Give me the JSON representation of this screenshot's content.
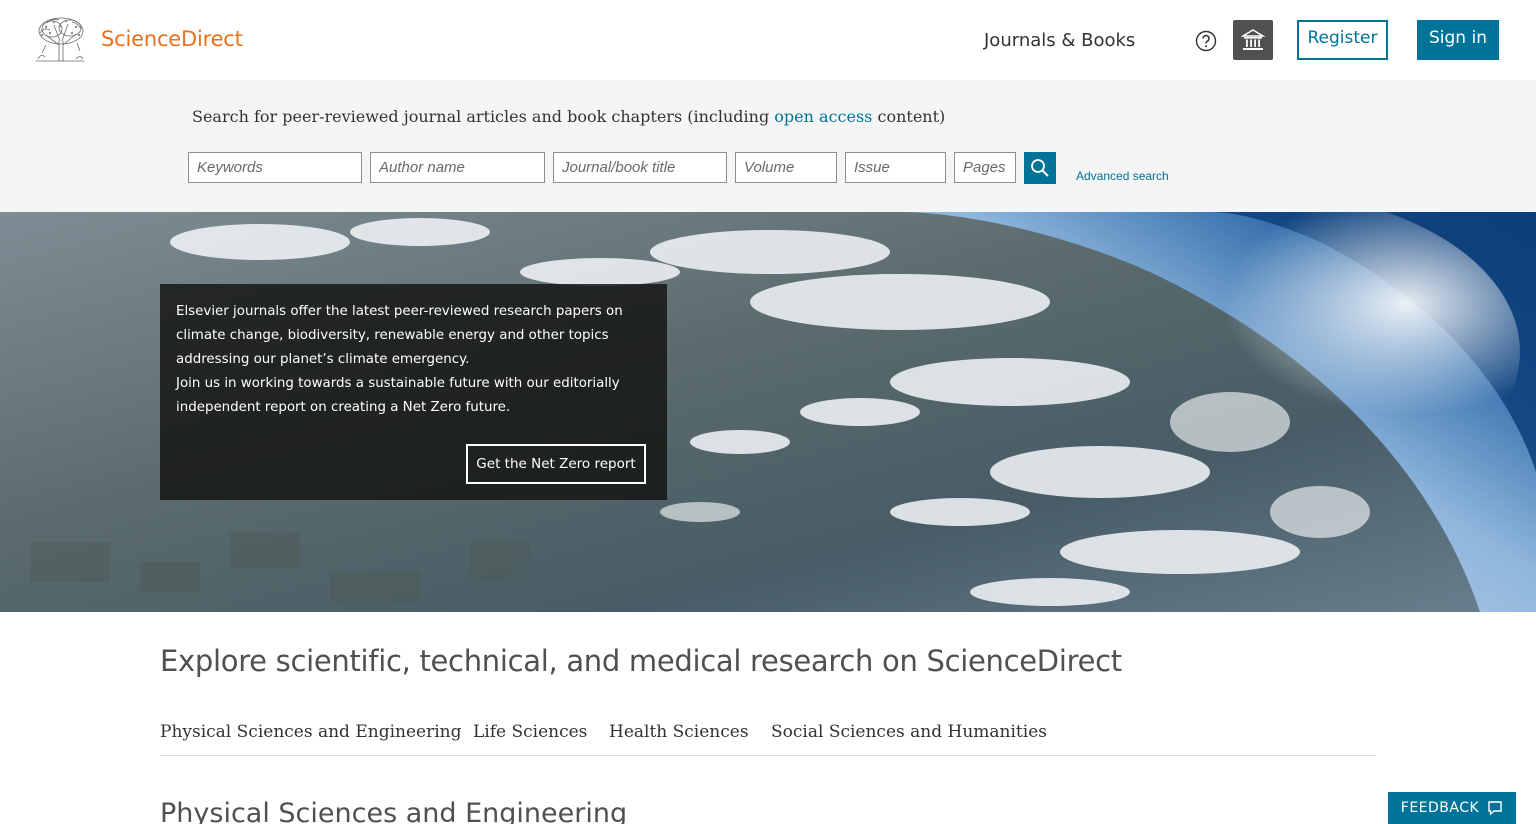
{
  "header": {
    "brand": "ScienceDirect",
    "nav_journals": "Journals & Books",
    "help_icon": "help-circle-icon",
    "institution_icon": "institution-icon",
    "register_label": "Register",
    "signin_label": "Sign in"
  },
  "search": {
    "intro_prefix": "Search for peer-reviewed journal articles and book chapters (including",
    "intro_link": "open access",
    "intro_suffix": "content)",
    "keywords_placeholder": "Keywords",
    "author_placeholder": "Author name",
    "journal_placeholder": "Journal/book title",
    "volume_placeholder": "Volume",
    "issue_placeholder": "Issue",
    "pages_placeholder": "Pages",
    "submit_icon": "search-icon",
    "advanced_label": "Advanced search"
  },
  "hero": {
    "paragraph_1": "Elsevier journals offer the latest peer-reviewed research papers on climate change, biodiversity, renewable energy and other topics addressing our planet’s climate emergency.",
    "paragraph_2": "Join us in working towards a sustainable future with our editorially independent report on creating a Net Zero future.",
    "cta_label": "Get the Net Zero report"
  },
  "explore": {
    "title": "Explore scientific, technical, and medical research on ScienceDirect",
    "tabs": [
      {
        "label": "Physical Sciences and Engineering"
      },
      {
        "label": "Life Sciences"
      },
      {
        "label": "Health Sciences"
      },
      {
        "label": "Social Sciences and Humanities"
      }
    ],
    "section_heading": "Physical Sciences and Engineering"
  },
  "feedback": {
    "label": "FEEDBACK",
    "icon": "speech-bubble-icon"
  },
  "colors": {
    "brand_orange": "#e9711c",
    "accent_blue": "#007398",
    "dark_button": "#505050"
  }
}
